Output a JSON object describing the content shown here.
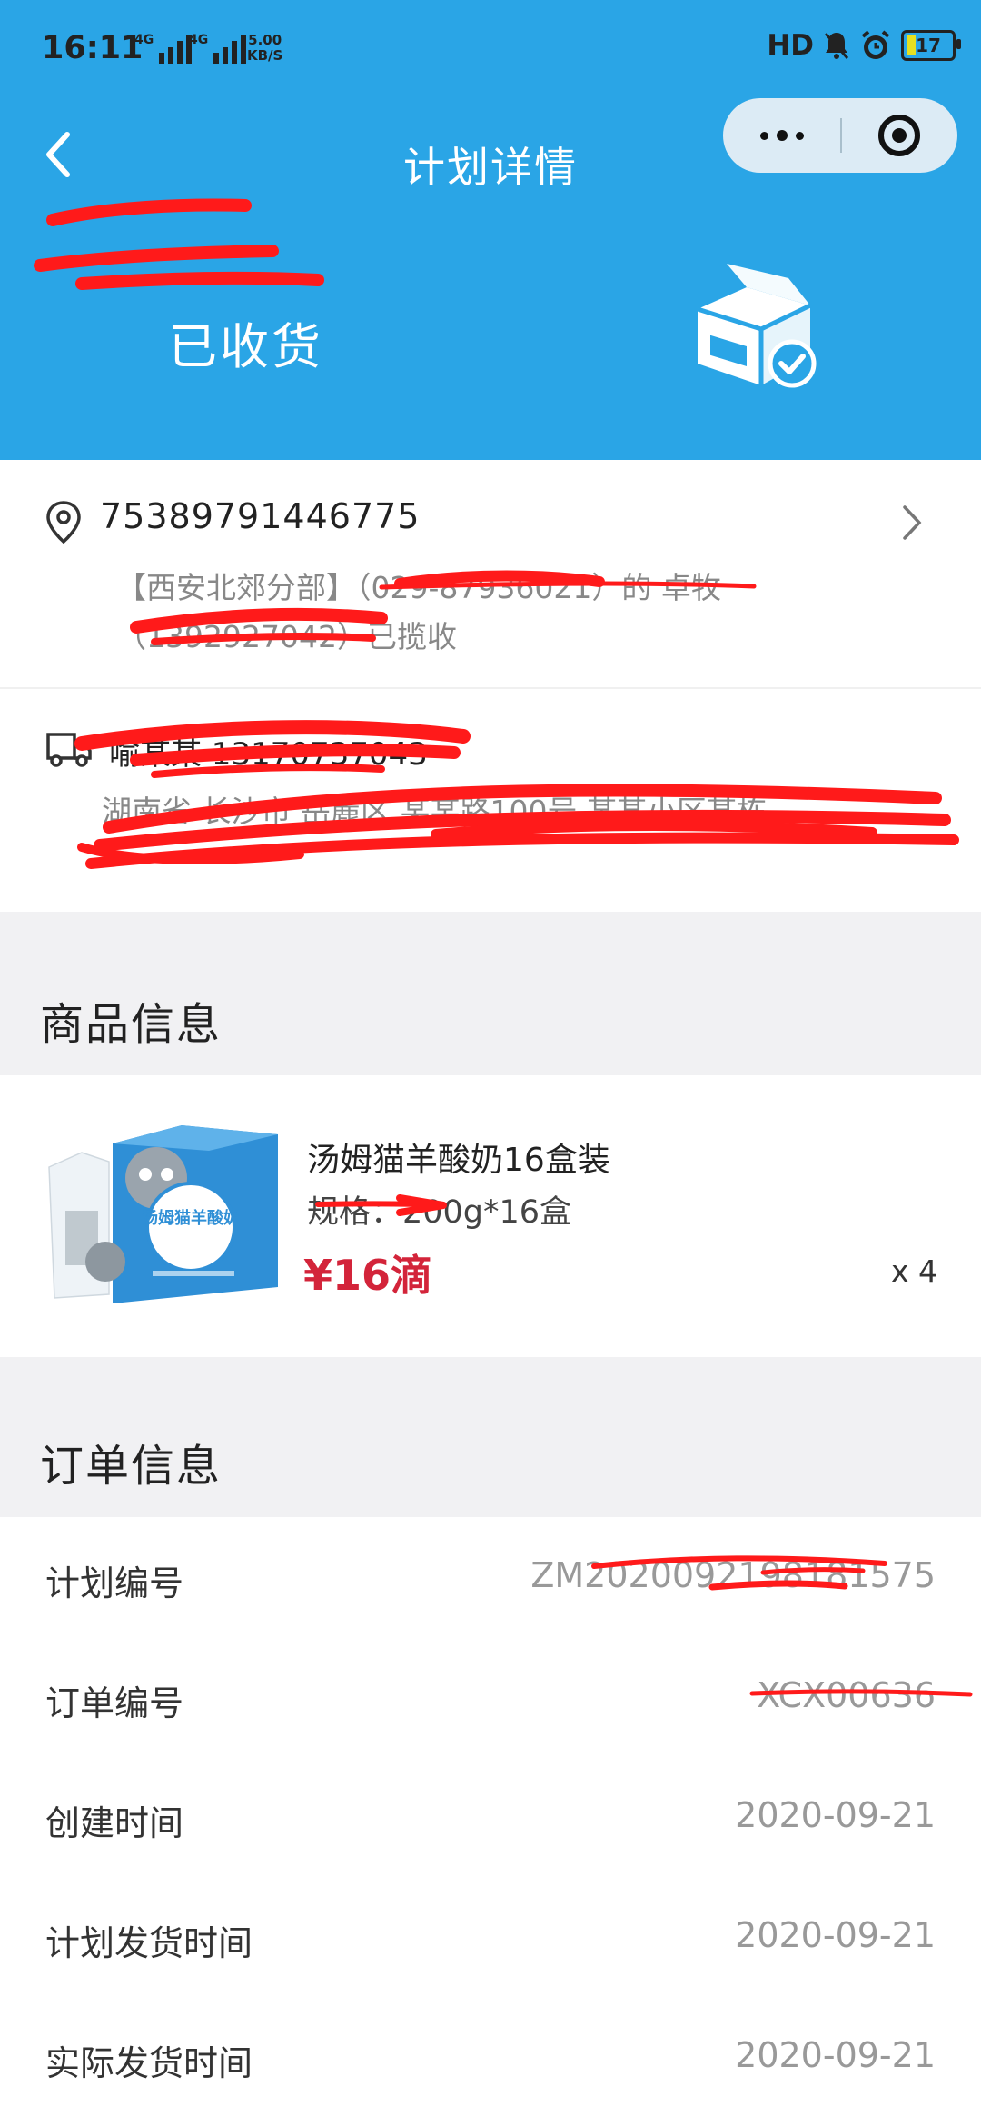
{
  "status_bar": {
    "time": "16:11",
    "network_1": "4G",
    "network_2": "4G",
    "speed": "5.00",
    "speed_unit": "KB/S",
    "hd": "HD",
    "battery": "17"
  },
  "nav": {
    "title": "计划详情"
  },
  "header": {
    "status": "已收货"
  },
  "logistics": {
    "tracking_no": "75389791446775",
    "desc_line1": "【西安北郊分部】（029-87936021）的 卓牧",
    "desc_line2": "（1392927042）已揽收"
  },
  "receiver": {
    "name_phone": "喻某某 13170737043",
    "address": "湖南省 长沙市 岳麓区 某某路100号 某某小区某栋"
  },
  "goods_section": {
    "title": "商品信息",
    "item": {
      "name": "汤姆猫羊酸奶16盒装",
      "spec": "规格：200g*16盒",
      "price": "¥16滴",
      "qty": "x 4",
      "image_text": "汤姆猫羊酸奶"
    }
  },
  "order_section": {
    "title": "订单信息",
    "rows": [
      {
        "key": "计划编号",
        "value": "ZM2020092198181575"
      },
      {
        "key": "订单编号",
        "value": "XCX00636"
      },
      {
        "key": "创建时间",
        "value": "2020-09-21"
      },
      {
        "key": "计划发货时间",
        "value": "2020-09-21"
      },
      {
        "key": "实际发货时间",
        "value": "2020-09-21"
      }
    ]
  },
  "colors": {
    "header_blue": "#2aa5e6",
    "price_red": "#d3243a",
    "section_bg": "#f1f1f3",
    "redaction_red": "#ff1a1a"
  }
}
